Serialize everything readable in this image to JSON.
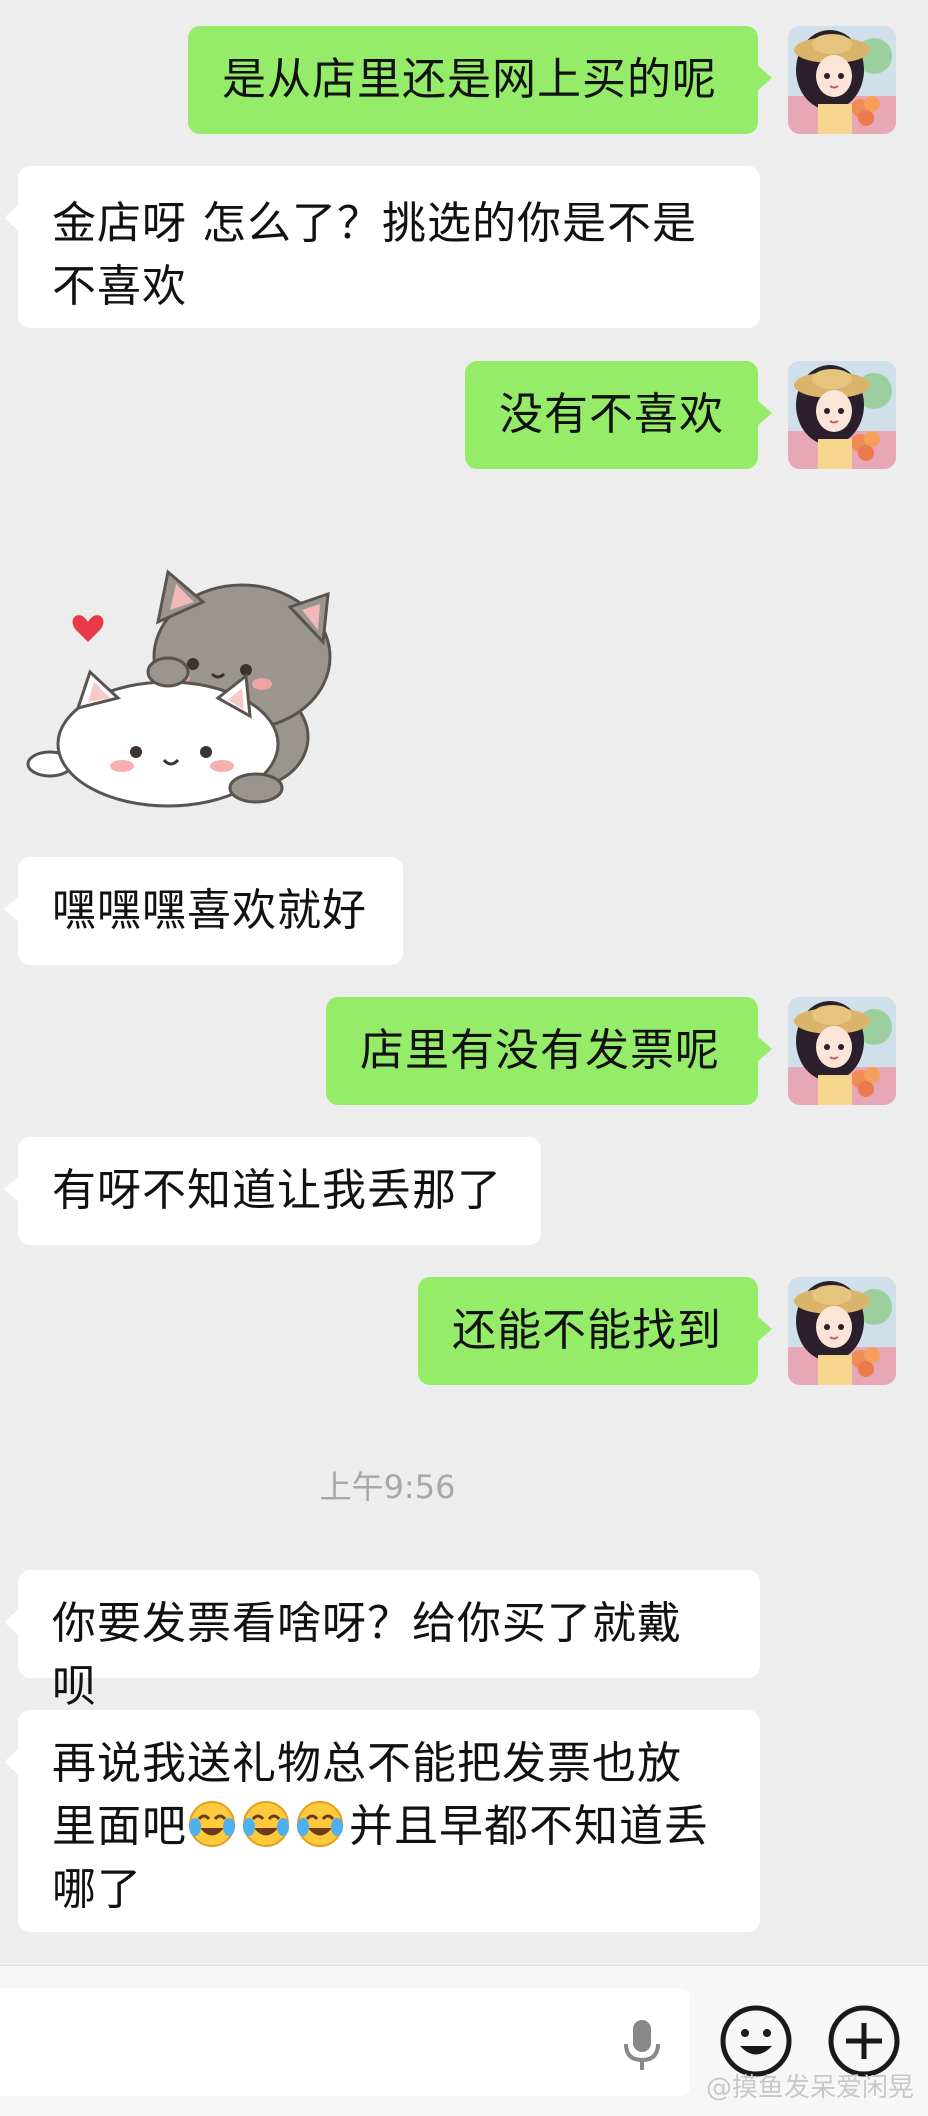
{
  "messages": [
    {
      "side": "me",
      "text": "是从店里还是网上买的呢"
    },
    {
      "side": "them",
      "text": "金店呀 怎么了？挑选的你是不是不喜欢"
    },
    {
      "side": "me",
      "text": "没有不喜欢"
    },
    {
      "side": "them",
      "type": "sticker",
      "sticker": "two-cats-hug-sticker"
    },
    {
      "side": "them",
      "text": "嘿嘿嘿喜欢就好"
    },
    {
      "side": "me",
      "text": "店里有没有发票呢"
    },
    {
      "side": "them",
      "text": "有呀不知道让我丢那了"
    },
    {
      "side": "me",
      "text": "还能不能找到"
    },
    {
      "side": "them",
      "text": "你要发票看啥呀？给你买了就戴呗"
    },
    {
      "side": "them",
      "text_before_emoji": "再说我送礼物总不能把发票也放里面吧",
      "emoji": [
        "crying-laughing-emoji",
        "crying-laughing-emoji",
        "crying-laughing-emoji"
      ],
      "text_after_emoji": "并且早都不知道丢哪了"
    }
  ],
  "timestamp": "上午9:56",
  "input_bar": {
    "mic_icon": "microphone-icon",
    "emoji_icon": "smiley-face-icon",
    "plus_icon": "plus-icon"
  },
  "watermark": "@摸鱼发呆爱闲晃",
  "colors": {
    "background": "#ededed",
    "my_bubble": "#95ec69",
    "their_bubble": "#ffffff",
    "timestamp": "#a8a8a8"
  }
}
